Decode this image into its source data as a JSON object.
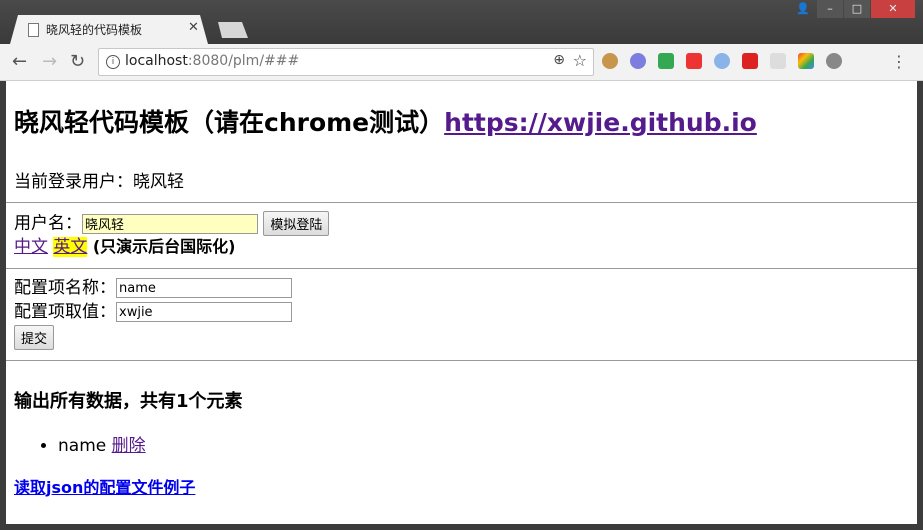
{
  "browser": {
    "tab_title": "晓风轻的代码模板",
    "url_host": "localhost",
    "url_rest": ":8080/plm/###"
  },
  "page": {
    "title": "晓风轻代码模板（请在chrome测试）",
    "site_link": "https://xwjie.github.io",
    "current_user_label": "当前登录用户：",
    "current_user": "晓风轻",
    "username_label": "用户名：",
    "username_value": "晓风轻",
    "login_button": "模拟登陆",
    "lang_zh": "中文",
    "lang_en": "英文",
    "lang_note": "(只演示后台国际化)",
    "config_name_label": "配置项名称：",
    "config_name_value": "name",
    "config_value_label": "配置项取值：",
    "config_value_value": "xwjie",
    "submit_button": "提交",
    "output_heading": "输出所有数据，共有1个元素",
    "items": [
      {
        "name": "name",
        "delete_label": "删除"
      }
    ],
    "json_link": "读取json的配置文件例子"
  },
  "colors": {
    "visited_link": "#551a8b",
    "link": "#0000ee",
    "autofill": "#ffffc0",
    "highlight": "#ffff00"
  }
}
